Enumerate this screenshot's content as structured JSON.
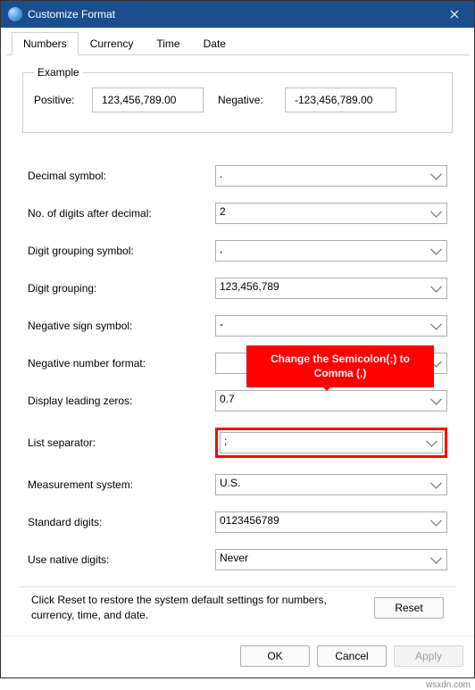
{
  "window": {
    "title": "Customize Format"
  },
  "tabs": [
    "Numbers",
    "Currency",
    "Time",
    "Date"
  ],
  "example": {
    "legend": "Example",
    "pos_label": "Positive:",
    "pos_value": "123,456,789.00",
    "neg_label": "Negative:",
    "neg_value": "-123,456,789.00"
  },
  "fields": {
    "decimal_symbol": {
      "label": "Decimal symbol:",
      "value": "."
    },
    "digits_after": {
      "label": "No. of digits after decimal:",
      "value": "2"
    },
    "grouping_symbol": {
      "label": "Digit grouping symbol:",
      "value": ","
    },
    "grouping": {
      "label": "Digit grouping:",
      "value": "123,456,789"
    },
    "neg_sign": {
      "label": "Negative sign symbol:",
      "value": "-"
    },
    "neg_format": {
      "label": "Negative number format:",
      "value": ""
    },
    "leading_zeros": {
      "label": "Display leading zeros:",
      "value": "0.7"
    },
    "list_sep": {
      "label": "List separator:",
      "value": ";"
    },
    "measurement": {
      "label": "Measurement system:",
      "value": "U.S."
    },
    "std_digits": {
      "label": "Standard digits:",
      "value": "0123456789"
    },
    "native_digits": {
      "label": "Use native digits:",
      "value": "Never"
    }
  },
  "callout": "Change the Semicolon(;) to Comma (,)",
  "reset": {
    "text": "Click Reset to restore the system default settings for numbers, currency, time, and date.",
    "button": "Reset"
  },
  "footer": {
    "ok": "OK",
    "cancel": "Cancel",
    "apply": "Apply"
  },
  "watermark": "wsxdn.com"
}
